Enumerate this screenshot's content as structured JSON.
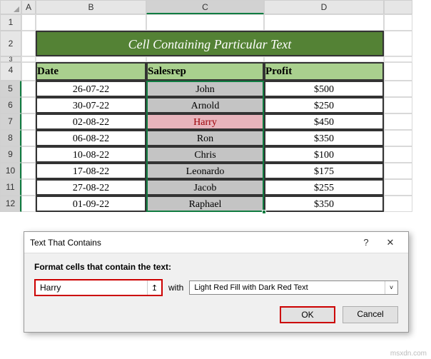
{
  "columns": {
    "A": "A",
    "B": "B",
    "C": "C",
    "D": "D",
    "E": ""
  },
  "rows": [
    "1",
    "2",
    "3",
    "4",
    "5",
    "6",
    "7",
    "8",
    "9",
    "10",
    "11",
    "12"
  ],
  "title": "Cell Containing Particular Text",
  "table": {
    "headers": {
      "date": "Date",
      "salesrep": "Salesrep",
      "profit": "Profit"
    },
    "data": [
      {
        "date": "26-07-22",
        "salesrep": "John",
        "profit": "$500"
      },
      {
        "date": "30-07-22",
        "salesrep": "Arnold",
        "profit": "$250"
      },
      {
        "date": "02-08-22",
        "salesrep": "Harry",
        "profit": "$450"
      },
      {
        "date": "06-08-22",
        "salesrep": "Ron",
        "profit": "$350"
      },
      {
        "date": "10-08-22",
        "salesrep": "Chris",
        "profit": "$100"
      },
      {
        "date": "17-08-22",
        "salesrep": "Leonardo",
        "profit": "$175"
      },
      {
        "date": "27-08-22",
        "salesrep": "Jacob",
        "profit": "$255"
      },
      {
        "date": "01-09-22",
        "salesrep": "Raphael",
        "profit": "$350"
      }
    ],
    "highlighted_row_index": 2
  },
  "dialog": {
    "title": "Text That Contains",
    "label": "Format cells that contain the text:",
    "input_value": "Harry",
    "with_label": "with",
    "format_option": "Light Red Fill with Dark Red Text",
    "ok_label": "OK",
    "cancel_label": "Cancel",
    "help_icon": "?",
    "close_icon": "✕",
    "range_icon": "↥",
    "dropdown_icon": "˅"
  },
  "watermark": "msxdn.com"
}
